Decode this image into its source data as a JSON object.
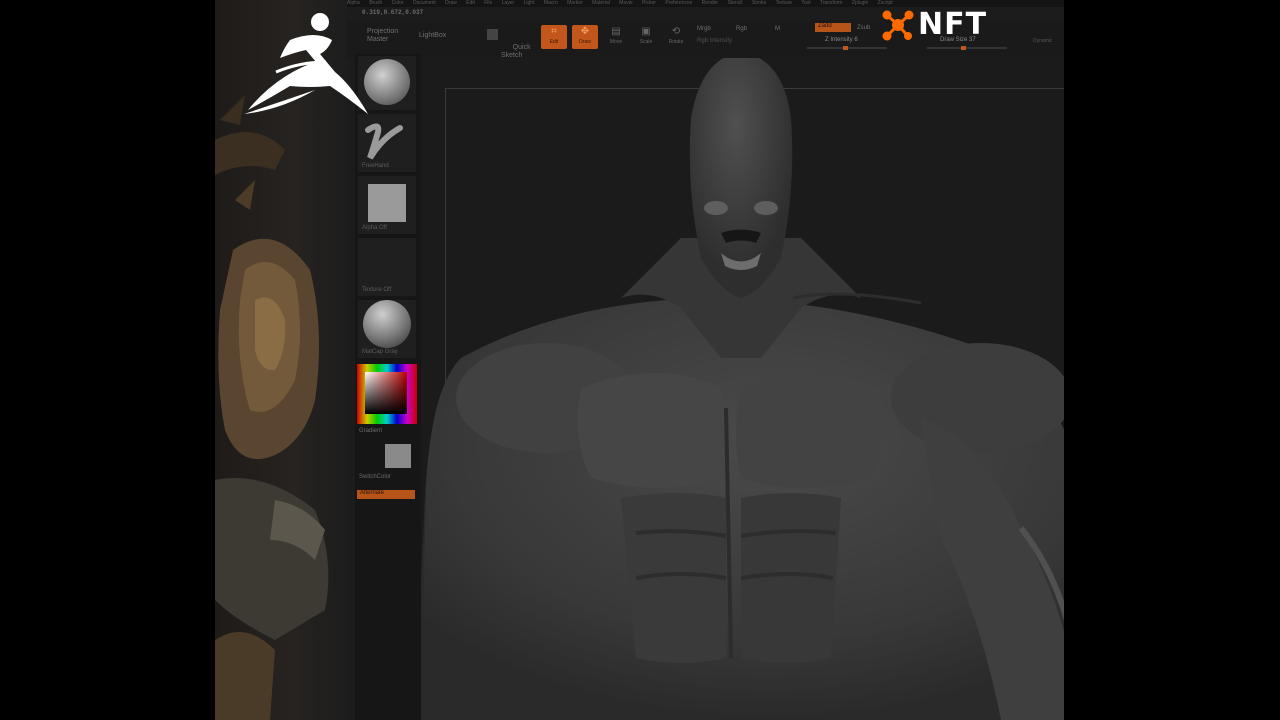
{
  "menu": [
    "Alpha",
    "Brush",
    "Color",
    "Document",
    "Draw",
    "Edit",
    "File",
    "Layer",
    "Light",
    "Macro",
    "Marker",
    "Material",
    "Movie",
    "Picker",
    "Preferences",
    "Render",
    "Stencil",
    "Stroke",
    "Texture",
    "Tool",
    "Transform",
    "Zplugin",
    "Zscript"
  ],
  "coords": "0.319,0.672,0.037",
  "toolbar": {
    "projection_master": "Projection\nMaster",
    "lightbox": "LightBox",
    "quick_sketch": "Quick\nSketch",
    "edit": "Edit",
    "draw": "Draw",
    "move": "Move",
    "scale": "Scale",
    "rotate": "Rotate",
    "mrgb": "Mrgb",
    "rgb": "Rgb",
    "m": "M",
    "rgb_intensity": "Rgb Intensity",
    "zadd": "Zadd",
    "zsub": "Zsub",
    "z_intensity": "Z Intensity 6",
    "draw_size": "Draw Size 37",
    "dynamic": "Dynamic"
  },
  "shelf": {
    "brush_caption": "Standard",
    "stroke_caption": "FreeHand",
    "alpha_caption": "Alpha Off",
    "texture_caption": "Texture Off",
    "material_caption": "MatCap Gray",
    "gradient": "Gradient",
    "switchcolor": "SwitchColor",
    "alternate": "Alternate"
  },
  "logos": {
    "left_logo": "zbrush-logo",
    "right_text": "NFT",
    "right_color": "#ff6a00"
  },
  "colors": {
    "accent": "#c2561b",
    "background": "#1b1b1b"
  }
}
